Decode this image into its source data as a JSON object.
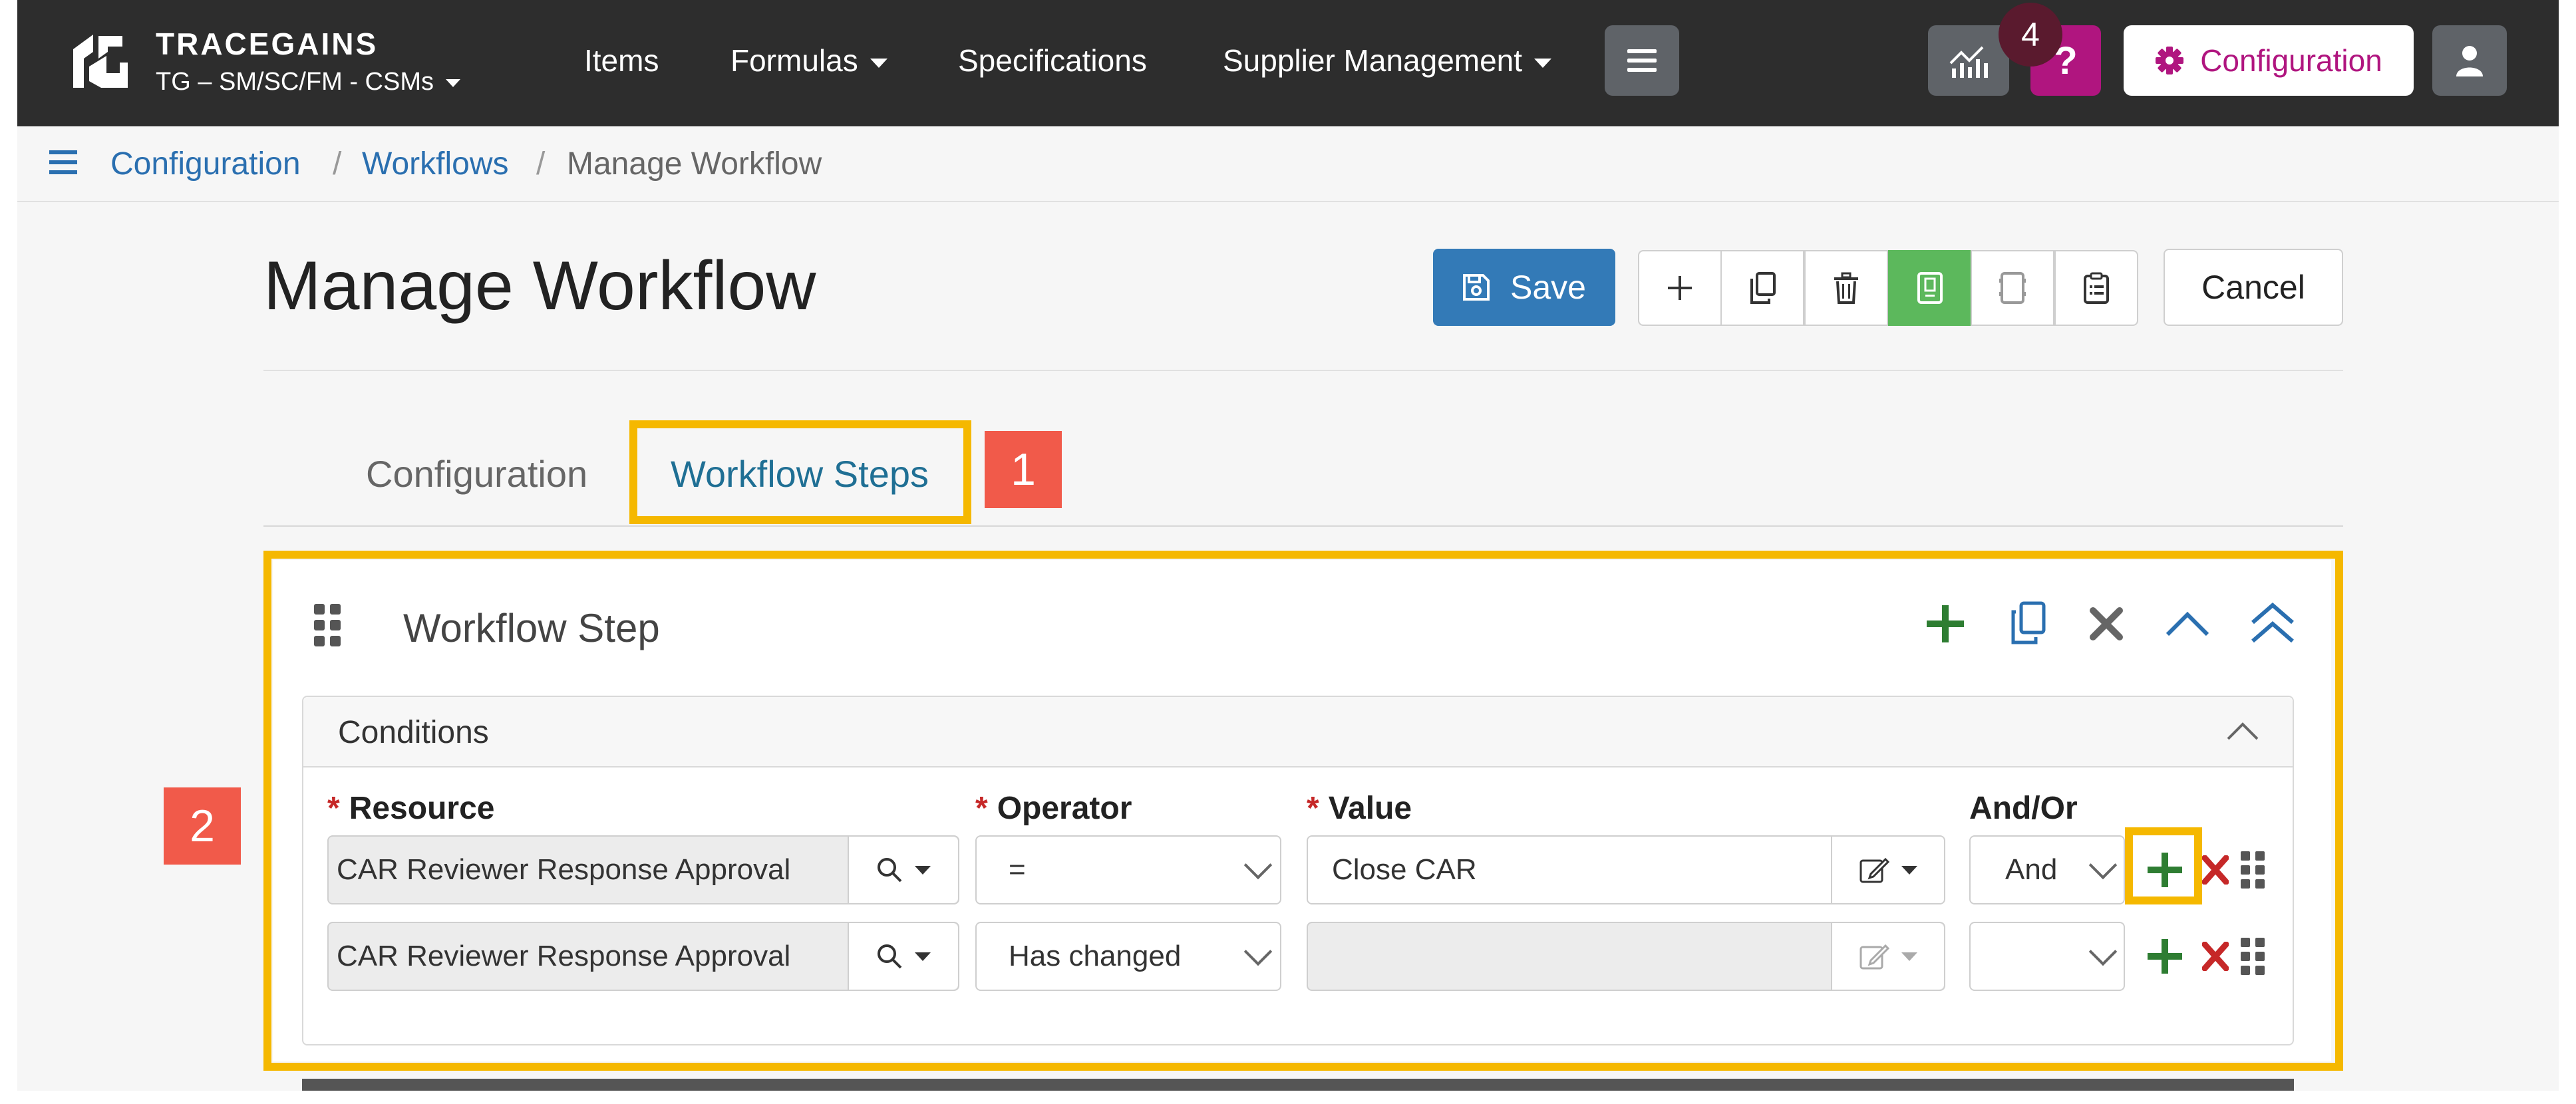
{
  "brand": {
    "name": "TRACEGAINS",
    "org": "TG – SM/SC/FM - CSMs"
  },
  "nav": {
    "items": [
      "Items",
      "Formulas",
      "Specifications",
      "Supplier Management"
    ],
    "notification_count": "4",
    "help_label": "?",
    "config_label": "Configuration"
  },
  "breadcrumb": {
    "items": [
      "Configuration",
      "Workflows",
      "Manage Workflow"
    ],
    "separator": "/"
  },
  "page": {
    "title": "Manage Workflow",
    "save_label": "Save",
    "cancel_label": "Cancel"
  },
  "tabs": {
    "items": [
      "Configuration",
      "Workflow Steps"
    ],
    "active": "Workflow Steps"
  },
  "callouts": {
    "one": "1",
    "two": "2"
  },
  "step": {
    "title": "Workflow Step",
    "conditions_title": "Conditions"
  },
  "conditions": {
    "headers": {
      "resource": "Resource",
      "operator": "Operator",
      "value": "Value",
      "andor": "And/Or",
      "required_mark": "*"
    },
    "rows": [
      {
        "resource": "CAR Reviewer Response Approval",
        "operator": "=",
        "value": "Close CAR",
        "andor": "And"
      },
      {
        "resource": "CAR Reviewer Response Approval",
        "operator": "Has changed",
        "value": "",
        "andor": ""
      }
    ]
  },
  "colors": {
    "nav_bg": "#2d2d2d",
    "link": "#2a6fb0",
    "save": "#337ab7",
    "active_tool": "#5cb85c",
    "help": "#b0157f",
    "add": "#2e7d32",
    "remove": "#c62828",
    "highlight": "#f5b800",
    "callout": "#f15a4a"
  }
}
